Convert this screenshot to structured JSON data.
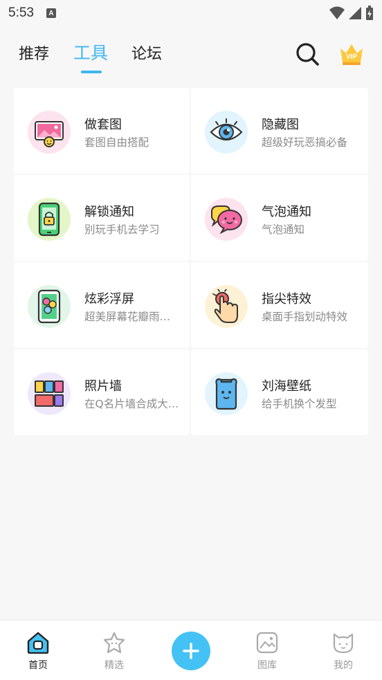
{
  "status_bar": {
    "time": "5:53",
    "notif_letter": "A"
  },
  "top_nav": {
    "tabs": [
      {
        "label": "推荐",
        "active": false
      },
      {
        "label": "工具",
        "active": true
      },
      {
        "label": "论坛",
        "active": false
      }
    ],
    "accent": "#3fb7ef",
    "vip_label": "VIP"
  },
  "tools": [
    {
      "title": "做套图",
      "desc": "套图自由搭配",
      "icon": "picture-smile-icon"
    },
    {
      "title": "隐藏图",
      "desc": "超级好玩恶搞必备",
      "icon": "eye-icon"
    },
    {
      "title": "解锁通知",
      "desc": "别玩手机去学习",
      "icon": "phone-lock-icon"
    },
    {
      "title": "气泡通知",
      "desc": "气泡通知",
      "icon": "chat-bubble-icon"
    },
    {
      "title": "炫彩浮屏",
      "desc": "超美屏幕花瓣雨…",
      "icon": "flower-screen-icon"
    },
    {
      "title": "指尖特效",
      "desc": "桌面手指划动特效",
      "icon": "finger-tap-icon"
    },
    {
      "title": "照片墙",
      "desc": "在Q名片墙合成大…",
      "icon": "photo-grid-icon"
    },
    {
      "title": "刘海壁纸",
      "desc": "给手机换个发型",
      "icon": "notch-phone-icon"
    }
  ],
  "bottom_nav": {
    "items": [
      {
        "label": "首页",
        "active": true,
        "icon": "home-icon"
      },
      {
        "label": "精选",
        "active": false,
        "icon": "star-icon"
      },
      {
        "label": "图库",
        "active": false,
        "icon": "gallery-icon"
      },
      {
        "label": "我的",
        "active": false,
        "icon": "cat-face-icon"
      }
    ],
    "fab_icon": "plus-icon",
    "fab_color": "#45c2f5"
  }
}
